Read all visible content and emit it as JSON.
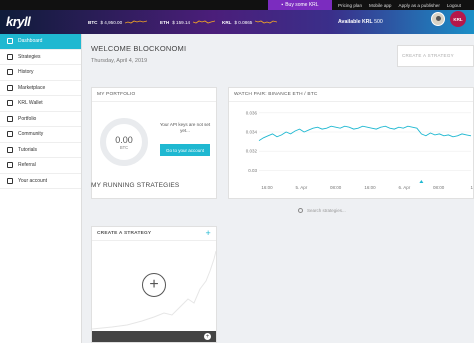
{
  "topbar": {
    "buy_label": "Buy some KRL",
    "links": [
      "Pricing plan",
      "Mobile app",
      "Apply as a publisher",
      "Logout"
    ]
  },
  "header": {
    "logo": "kryll",
    "tickers": [
      {
        "symbol": "BTC",
        "value": "$ 4,950.00"
      },
      {
        "symbol": "ETH",
        "value": "$ 159.14"
      },
      {
        "symbol": "KRL",
        "value": "$ 0.0865"
      }
    ],
    "available_label": "Available KRL",
    "available_value": "500",
    "badge": "KRL"
  },
  "sidebar": {
    "items": [
      {
        "label": "Dashboard",
        "icon": "dashboard-icon",
        "active": true
      },
      {
        "label": "Strategies",
        "icon": "strategies-icon"
      },
      {
        "label": "History",
        "icon": "history-icon"
      },
      {
        "label": "Marketplace",
        "icon": "marketplace-icon"
      },
      {
        "label": "KRL Wallet",
        "icon": "wallet-icon"
      },
      {
        "label": "Portfolio",
        "icon": "portfolio-icon"
      },
      {
        "label": "Community",
        "icon": "community-icon"
      },
      {
        "label": "Tutorials",
        "icon": "tutorials-icon"
      },
      {
        "label": "Referral",
        "icon": "referral-icon"
      },
      {
        "label": "Your account",
        "icon": "account-icon"
      }
    ]
  },
  "main": {
    "welcome": "WELCOME BLOCKONOMI",
    "date": "Thursday, April 4, 2019",
    "create_placeholder": "CREATE A STRATEGY",
    "portfolio": {
      "title": "MY PORTFOLIO",
      "value": "0.00",
      "currency": "BTC",
      "api_message": "Your API keys are not set yet...",
      "button": "Go to your account"
    },
    "watch": {
      "title": "WATCH PAIR: BINANCE ETH / BTC"
    },
    "running_title": "MY RUNNING STRATEGIES",
    "search_placeholder": "Search strategies...",
    "strategy_card_title": "CREATE A STRATEGY"
  },
  "chart_data": {
    "type": "line",
    "title": "WATCH PAIR: BINANCE ETH / BTC",
    "x_ticks": [
      "16:00",
      "5. Apr",
      "08:00",
      "16:00",
      "6. Apr",
      "08:00",
      "16"
    ],
    "y_ticks": [
      0.03,
      0.032,
      0.034,
      0.036
    ],
    "ylim": [
      0.029,
      0.0365
    ],
    "series": [
      {
        "color": "#1fb8d1",
        "values": [
          0.0331,
          0.0334,
          0.0336,
          0.0338,
          0.0335,
          0.0337,
          0.034,
          0.0338,
          0.0341,
          0.0343,
          0.034,
          0.0342,
          0.0344,
          0.0345,
          0.0343,
          0.0344,
          0.0346,
          0.0345,
          0.0344,
          0.0346,
          0.0345,
          0.0343,
          0.0344,
          0.0346,
          0.0345,
          0.0344,
          0.0343,
          0.0345,
          0.0346,
          0.0344,
          0.0343,
          0.0345,
          0.0344,
          0.0346,
          0.0345,
          0.0344,
          0.0338,
          0.0336,
          0.0339,
          0.0337,
          0.0338,
          0.0336,
          0.0337,
          0.0335,
          0.0336,
          0.0338,
          0.0337,
          0.0336
        ]
      }
    ],
    "grid": true
  }
}
